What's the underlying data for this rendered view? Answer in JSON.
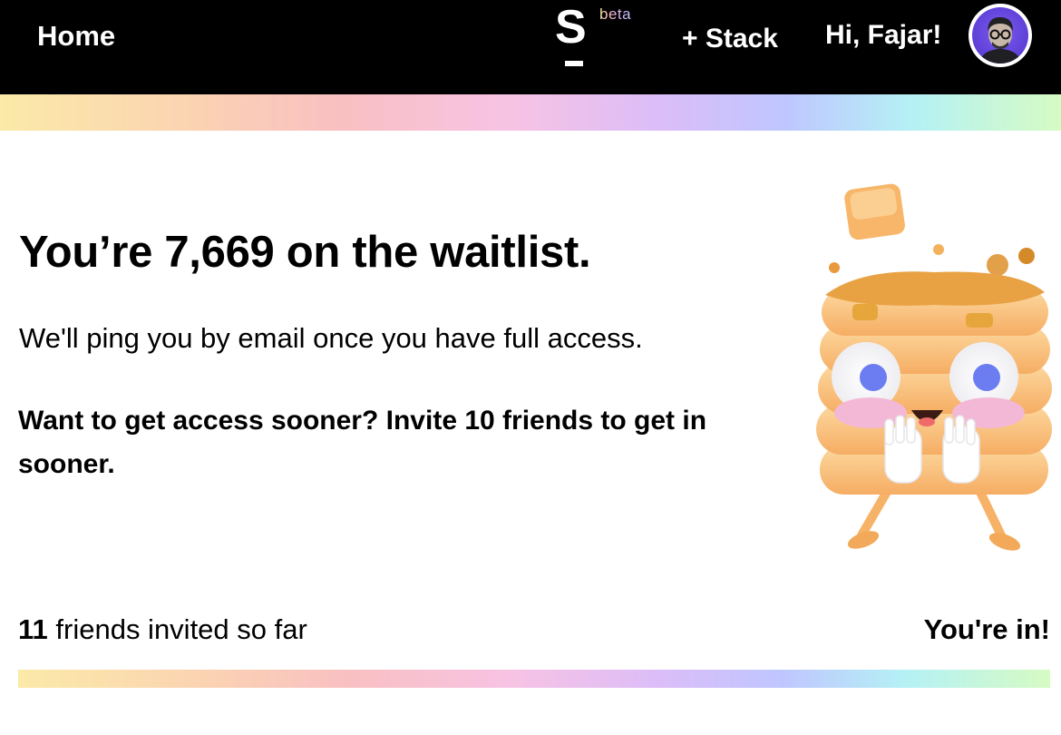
{
  "nav": {
    "home_label": "Home",
    "logo_letter": "S",
    "beta_label": "beta",
    "stack_label": "+ Stack",
    "greeting": "Hi, Fajar!",
    "avatar_icon": "user-avatar"
  },
  "waitlist": {
    "headline": "You’re 7,669 on the waitlist.",
    "subtext": "We'll ping you by email once you have full access.",
    "invite_cta": "Want to get access sooner? Invite 10 friends to get in sooner."
  },
  "progress": {
    "count": "11",
    "label_suffix": " friends invited so far",
    "goal_label": "You're in!"
  },
  "illustration": {
    "icon": "pancake-stack-mascot"
  },
  "colors": {
    "nav_background": "#000000",
    "gradient_stops": [
      "#fbeaa8",
      "#f9c0c2",
      "#f7c3e4",
      "#dcbdf8",
      "#bfc6ff",
      "#b5f1f5",
      "#d6fbc3"
    ]
  }
}
